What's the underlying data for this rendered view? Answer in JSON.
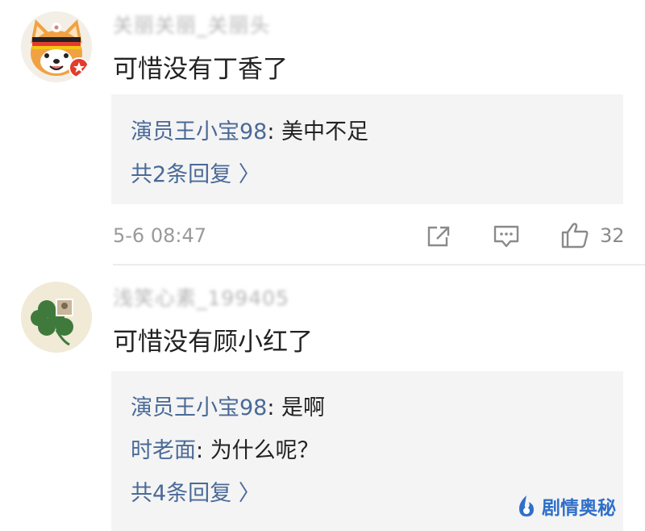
{
  "comments": [
    {
      "username": "关丽关丽_关丽头",
      "text": "可惜没有丁香了",
      "replies": [
        {
          "author": "演员王小宝98",
          "text": "美中不足"
        }
      ],
      "more_replies": "共2条回复 〉",
      "time": "5-6 08:47",
      "like_count": "32"
    },
    {
      "username": "浅笑心素_199405",
      "text": "可惜没有顾小红了",
      "replies": [
        {
          "author": "演员王小宝98",
          "text": "是啊"
        },
        {
          "author": "时老面",
          "text": "为什么呢？"
        }
      ],
      "more_replies": "共4条回复 〉"
    }
  ],
  "reply_separator": ": ",
  "watermark": "剧情奥秘",
  "colors": {
    "link": "#4a6a97",
    "reply_bg": "#f4f4f4",
    "meta": "#9a9a9a",
    "watermark": "#2f6fc9"
  }
}
